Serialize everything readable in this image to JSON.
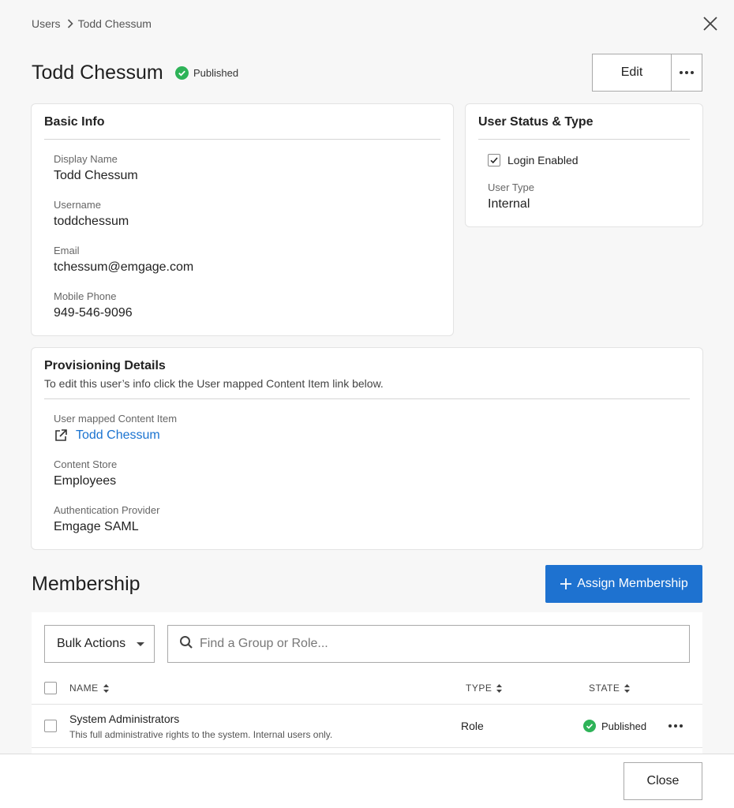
{
  "breadcrumb": {
    "parent": "Users",
    "current": "Todd Chessum"
  },
  "header": {
    "title": "Todd Chessum",
    "status": "Published",
    "edit_label": "Edit"
  },
  "basic_info": {
    "title": "Basic Info",
    "fields": [
      {
        "label": "Display Name",
        "value": "Todd Chessum"
      },
      {
        "label": "Username",
        "value": "toddchessum"
      },
      {
        "label": "Email",
        "value": "tchessum@emgage.com"
      },
      {
        "label": "Mobile Phone",
        "value": "949-546-9096"
      }
    ]
  },
  "user_status": {
    "title": "User Status & Type",
    "login_enabled_label": "Login Enabled",
    "login_enabled": true,
    "user_type_label": "User Type",
    "user_type": "Internal"
  },
  "provisioning": {
    "title": "Provisioning Details",
    "subtitle": "To edit this user’s info click the User mapped Content Item link below.",
    "mapped_label": "User mapped Content Item",
    "mapped_link": "Todd Chessum",
    "store_label": "Content Store",
    "store_value": "Employees",
    "auth_label": "Authentication Provider",
    "auth_value": "Emgage SAML"
  },
  "membership": {
    "title": "Membership",
    "assign_label": "Assign Membership",
    "bulk_actions": "Bulk Actions",
    "search_placeholder": "Find a Group or Role...",
    "columns": {
      "name": "NAME",
      "type": "TYPE",
      "state": "STATE"
    },
    "rows": [
      {
        "name": "System Administrators",
        "description": "This full administrative rights to the system. Internal users only.",
        "type": "Role",
        "state": "Published"
      }
    ]
  },
  "footer": {
    "close_label": "Close"
  },
  "colors": {
    "accent": "#1e72d0",
    "success": "#2eb358",
    "link": "#1a73d0"
  },
  "icons": [
    "chevron-right-icon",
    "close-icon",
    "check-circle-icon",
    "more-horizontal-icon",
    "checkbox-check-icon",
    "external-link-icon",
    "plus-icon",
    "caret-down-icon",
    "search-icon",
    "sort-icon"
  ]
}
